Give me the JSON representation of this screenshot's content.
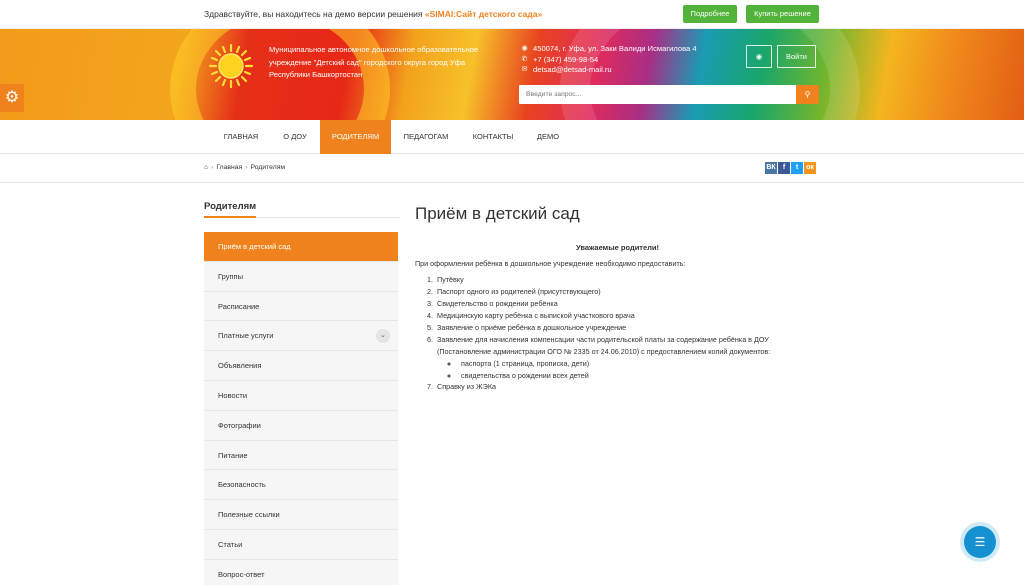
{
  "demo_bar": {
    "text": "Здравствуйте, вы находитесь на демо версии решения ",
    "product": "«SIMAI:Сайт детского сада»",
    "more_button": "Подробнее",
    "buy_button": "Купить решение"
  },
  "header": {
    "org_name": "Муниципальное автономное дошкольное образовательное учреждение \"Детский сад\" городского округа город Уфа Республики Башкортостан",
    "address": "450074, г. Уфа, ул. Заки Валиди Исмагилова 4",
    "phone": "+7 (347) 459-98-54",
    "email": "detsad@detsad-mail.ru",
    "login_button": "Войти",
    "search_placeholder": "Введите запрос..."
  },
  "nav": {
    "items": [
      "ГЛАВНАЯ",
      "О ДОУ",
      "РОДИТЕЛЯМ",
      "ПЕДАГОГАМ",
      "КОНТАКТЫ",
      "ДЕМО"
    ],
    "active": "РОДИТЕЛЯМ"
  },
  "breadcrumb": {
    "items": [
      "Главная",
      "Родителям"
    ]
  },
  "share": {
    "icons": [
      "vk-icon",
      "facebook-icon",
      "twitter-icon",
      "odnoklassniki-icon"
    ],
    "labels": [
      "ВК",
      "f",
      "t",
      "ок"
    ],
    "colors": [
      "#4c75a3",
      "#3b5998",
      "#1da1f2",
      "#f7931e"
    ]
  },
  "sidebar": {
    "title": "Родителям",
    "items": [
      "Приём в детский сад",
      "Группы",
      "Расписание",
      "Платные услуги",
      "Объявления",
      "Новости",
      "Фотографии",
      "Питание",
      "Безопасность",
      "Полезные ссылки",
      "Статьи",
      "Вопрос-ответ"
    ],
    "active_index": 0
  },
  "content": {
    "title": "Приём в детский сад",
    "greeting": "Уважаемые родители!",
    "intro": "При оформлении ребёнка в дошкольное учреждение необходимо предоставить:",
    "list": [
      "Путёвку",
      "Паспорт одного из родителей (присутствующего)",
      "Свидетельство о рождении ребёнка",
      "Медицинскую карту ребёнка с выпиской участкового врача",
      "Заявление о приёме ребёнка в дошкольное учреждение",
      "Заявление для начисления компенсации части родительской платы за содержание ребёнка в ДОУ (Постановление администрации ОГО № 2335 от 24.06.2010) с предоставлением копий документов:",
      "Справку из ЖЭКа"
    ],
    "sublist": [
      "паспорта (1 страница, прописка, дети)",
      "свидетельства о рождении всех детей"
    ]
  },
  "colors": {
    "accent": "#f0821e",
    "green": "#52b33b",
    "chat": "#1591d1"
  }
}
